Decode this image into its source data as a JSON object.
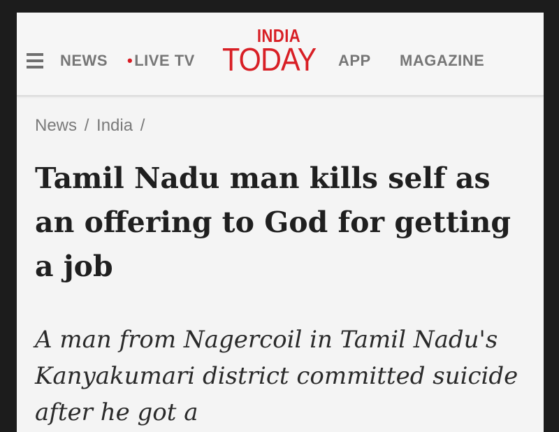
{
  "header": {
    "nav": {
      "news": "NEWS",
      "live_dot": "•",
      "live_tv": "LIVE TV",
      "app": "APP",
      "magazine": "MAGAZINE"
    },
    "logo": {
      "line1": "INDIA",
      "line2": "TODAY"
    },
    "menu_icon": "hamburger-menu-icon",
    "colors": {
      "brand": "#d81f25",
      "nav_text": "#767676"
    }
  },
  "breadcrumb": {
    "items": [
      "News",
      "India"
    ],
    "separator": "/"
  },
  "article": {
    "headline": "Tamil Nadu man kills self as an offering to God for getting a job",
    "standfirst": "A man from Nagercoil in Tamil Nadu's Kanyakumari district committed suicide after he got a"
  }
}
